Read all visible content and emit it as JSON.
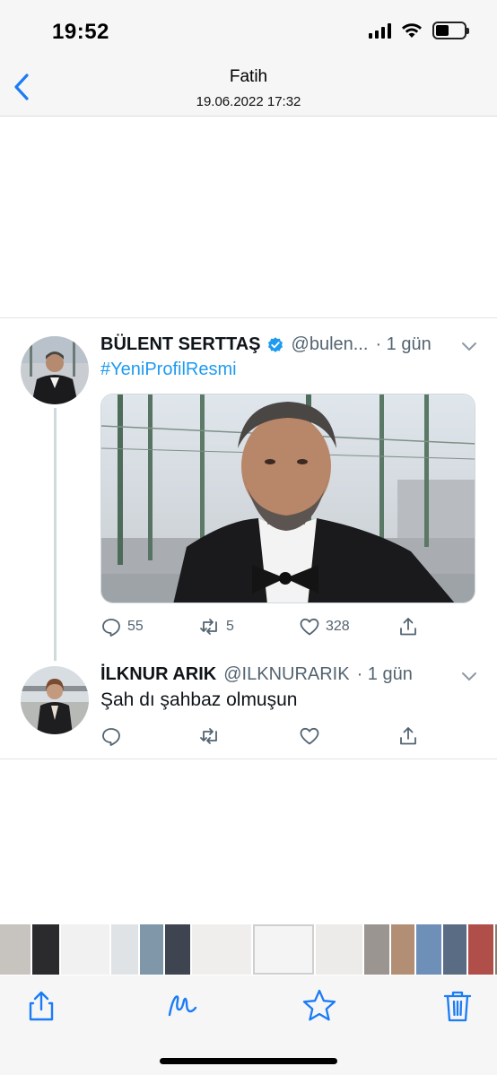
{
  "status_bar": {
    "time": "19:52"
  },
  "nav": {
    "title": "Fatih",
    "subtitle": "19.06.2022 17:32"
  },
  "tweet": {
    "name": "BÜLENT SERTTAŞ",
    "handle": "@bulen...",
    "time": "· 1 gün",
    "hashtag": "#YeniProfilResmi",
    "replies": "55",
    "retweets": "5",
    "likes": "328"
  },
  "reply": {
    "name": "İLKNUR ARIK",
    "handle": "@ILKNURARIK",
    "time": "· 1 gün",
    "text": "Şah dı şahbaz olmuşun"
  },
  "colors": {
    "accent": "#1d9bf0",
    "ios_blue": "#1b7cf5",
    "muted": "#536471"
  },
  "icons": [
    "back-chevron-icon",
    "verified-badge-icon",
    "reply-icon",
    "retweet-icon",
    "like-icon",
    "share-icon",
    "trash-icon",
    "markup-icon",
    "favorite-star-icon"
  ]
}
